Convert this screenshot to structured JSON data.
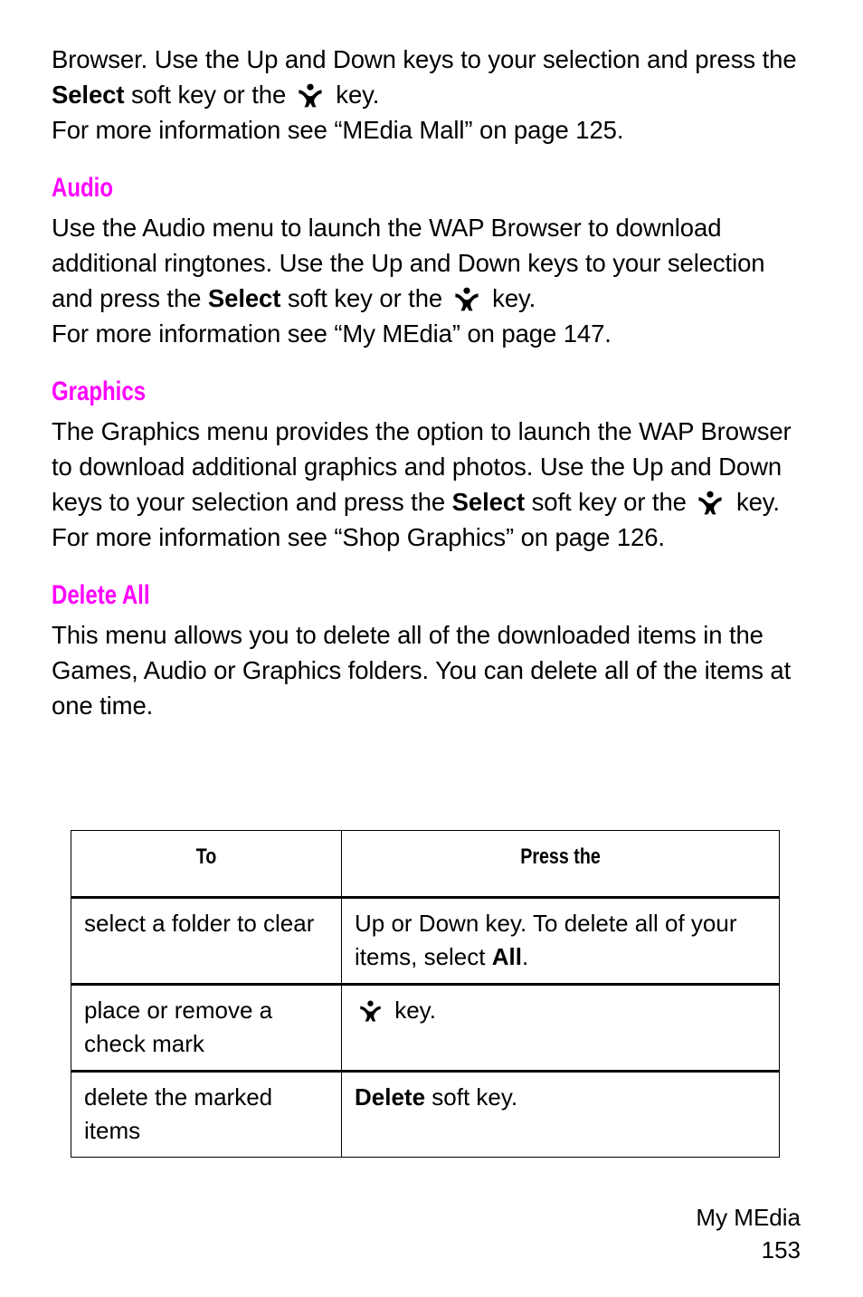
{
  "page": {
    "footer_section": "My MEdia",
    "footer_page_number": "153"
  },
  "intro": {
    "line1_a": "Browser.  Use the Up and Down keys to your selection and press the ",
    "line1_bold": "Select",
    "line1_b": " soft key or the ",
    "line1_c": " key.",
    "line2": "For more information see “MEdia Mall” on page 125."
  },
  "sections": [
    {
      "heading": "Audio",
      "body_a": "Use the Audio menu to launch the WAP Browser to download additional ringtones.  Use the Up and Down keys to your selection and press the ",
      "body_bold": "Select",
      "body_b": " soft key or the ",
      "body_c": " key.",
      "reference": "For more information see “My MEdia” on page 147."
    },
    {
      "heading": "Graphics",
      "body_a": "The Graphics menu provides the option to launch the WAP Browser to download additional graphics and photos. Use the Up and Down keys to your selection and press the ",
      "body_bold": "Select",
      "body_b": " soft key or the ",
      "body_c": " key.",
      "reference": "For more information see “Shop Graphics” on page 126."
    },
    {
      "heading": "Delete All",
      "body_a": "This menu allows you to delete all of the downloaded items in the Games, Audio or Graphics folders. You can delete all of the items at one time.",
      "body_bold": "",
      "body_b": "",
      "body_c": "",
      "reference": ""
    }
  ],
  "table": {
    "headers": {
      "col1": "To",
      "col2": "Press the"
    },
    "rows": [
      {
        "to": "select a folder to clear",
        "press_a": "Up or Down key. To delete all of your items, select ",
        "press_bold": "All",
        "press_b": ".",
        "has_icon": false
      },
      {
        "to": "place or remove a check mark",
        "press_a": "",
        "press_bold": "",
        "press_b": " key.",
        "has_icon": true
      },
      {
        "to": "delete the marked items",
        "press_a": "",
        "press_bold": "Delete",
        "press_b": " soft key.",
        "has_icon": false
      }
    ]
  },
  "icons": {
    "confirm_key": "person-key-icon"
  },
  "colors": {
    "heading": "#ff00ff",
    "text": "#000000",
    "background": "#ffffff",
    "rule": "#000000"
  }
}
